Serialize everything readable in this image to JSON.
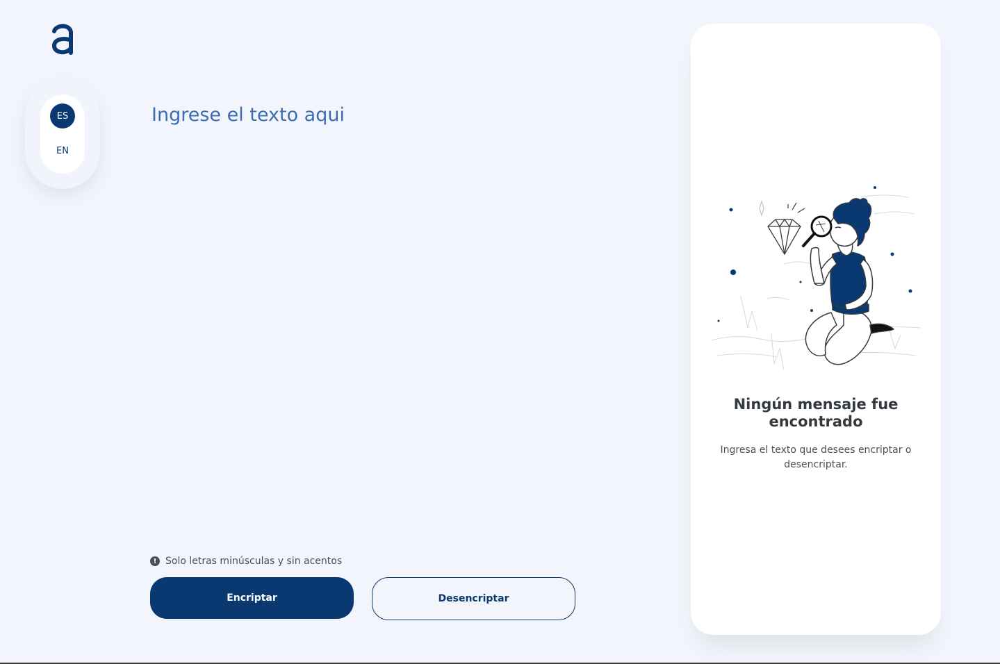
{
  "brand": {
    "logo_icon": "alura-a-logo-icon",
    "primary_color": "#0a3871",
    "background_color": "#f3f5fc"
  },
  "language": {
    "options": [
      {
        "code": "ES",
        "active": true
      },
      {
        "code": "EN",
        "active": false
      }
    ]
  },
  "editor": {
    "placeholder": "Ingrese el texto aqui",
    "value": ""
  },
  "hint": {
    "icon": "exclamation-circle-icon",
    "text": "Solo letras minúsculas y sin acentos"
  },
  "actions": {
    "encrypt_label": "Encriptar",
    "decrypt_label": "Desencriptar"
  },
  "output": {
    "illustration": "person-with-magnifying-glass-and-diamond-illustration",
    "title": "Ningún mensaje fue encontrado",
    "description": "Ingresa el texto que desees encriptar o desencriptar."
  }
}
